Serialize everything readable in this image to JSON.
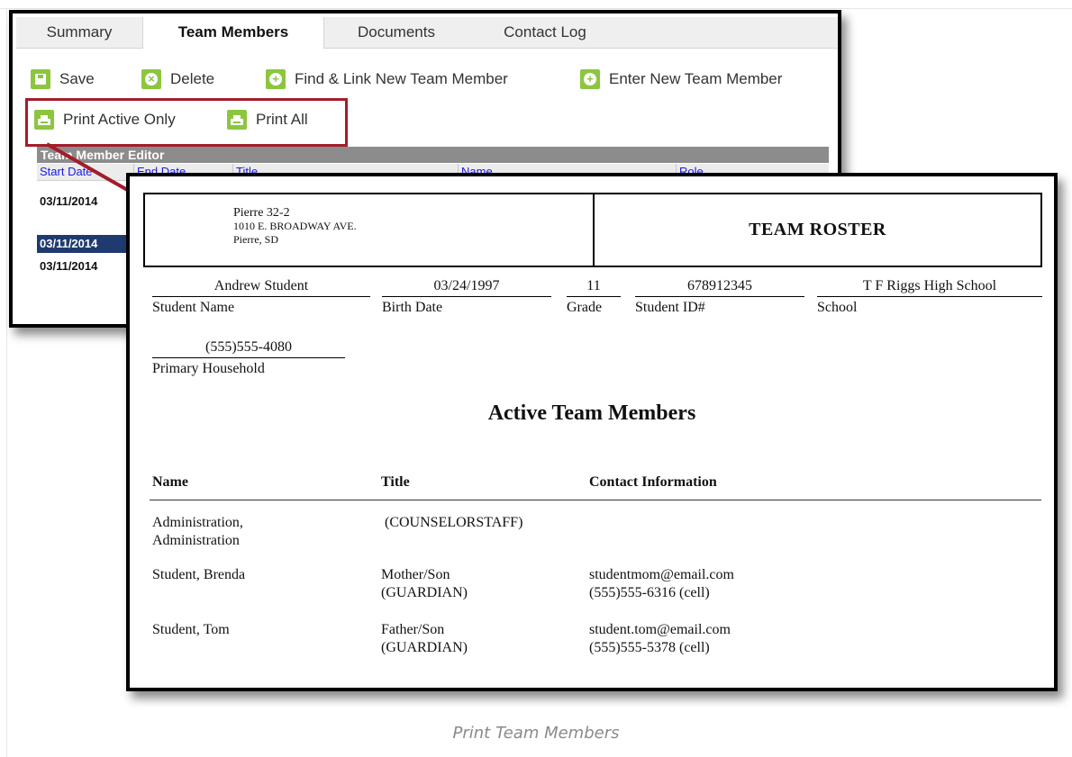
{
  "app": {
    "tabs": [
      {
        "label": "Summary"
      },
      {
        "label": "Team Members"
      },
      {
        "label": "Documents"
      },
      {
        "label": "Contact Log"
      }
    ],
    "toolbar": {
      "save": "Save",
      "delete": "Delete",
      "find_link": "Find & Link New Team Member",
      "enter_new": "Enter New Team Member",
      "print_active": "Print Active Only",
      "print_all": "Print All"
    },
    "editor": {
      "title": "Team Member Editor",
      "columns": [
        "Start Date",
        "End Date",
        "Title",
        "Name",
        "Role"
      ],
      "rows": [
        {
          "start_date": "03/11/2014"
        },
        {
          "start_date": "03/11/2014"
        },
        {
          "start_date": "03/11/2014"
        }
      ]
    }
  },
  "printout": {
    "school_name": "Pierre 32-2",
    "school_address": "1010 E. BROADWAY AVE.",
    "school_city": "Pierre, SD",
    "report_title": "TEAM ROSTER",
    "student": {
      "name": "Andrew Student",
      "birth_date": "03/24/1997",
      "grade": "11",
      "student_id": "678912345",
      "school": "T F Riggs High School",
      "phone": "(555)555-4080"
    },
    "labels": {
      "student_name": "Student Name",
      "birth_date": "Birth Date",
      "grade": "Grade",
      "student_id": "Student ID#",
      "school": "School",
      "primary_household": "Primary Household"
    },
    "section_title": "Active Team Members",
    "table_headers": [
      "Name",
      "Title",
      "Contact Information"
    ],
    "members": [
      {
        "name_line1": "Administration,",
        "name_line2": "Administration",
        "title_line1": "(COUNSELORSTAFF)",
        "title_line2": "",
        "contact_line1": "",
        "contact_line2": ""
      },
      {
        "name_line1": "Student, Brenda",
        "name_line2": "",
        "title_line1": "Mother/Son",
        "title_line2": "(GUARDIAN)",
        "contact_line1": "studentmom@email.com",
        "contact_line2": "(555)555-6316 (cell)"
      },
      {
        "name_line1": "Student, Tom",
        "name_line2": "",
        "title_line1": "Father/Son",
        "title_line2": "(GUARDIAN)",
        "contact_line1": "student.tom@email.com",
        "contact_line2": "(555)555-5378 (cell)"
      }
    ]
  },
  "caption": "Print Team Members",
  "colors": {
    "accent_green": "#8cc63f",
    "highlight_red": "#a31d2a",
    "selected_row": "#1f3a6e"
  }
}
